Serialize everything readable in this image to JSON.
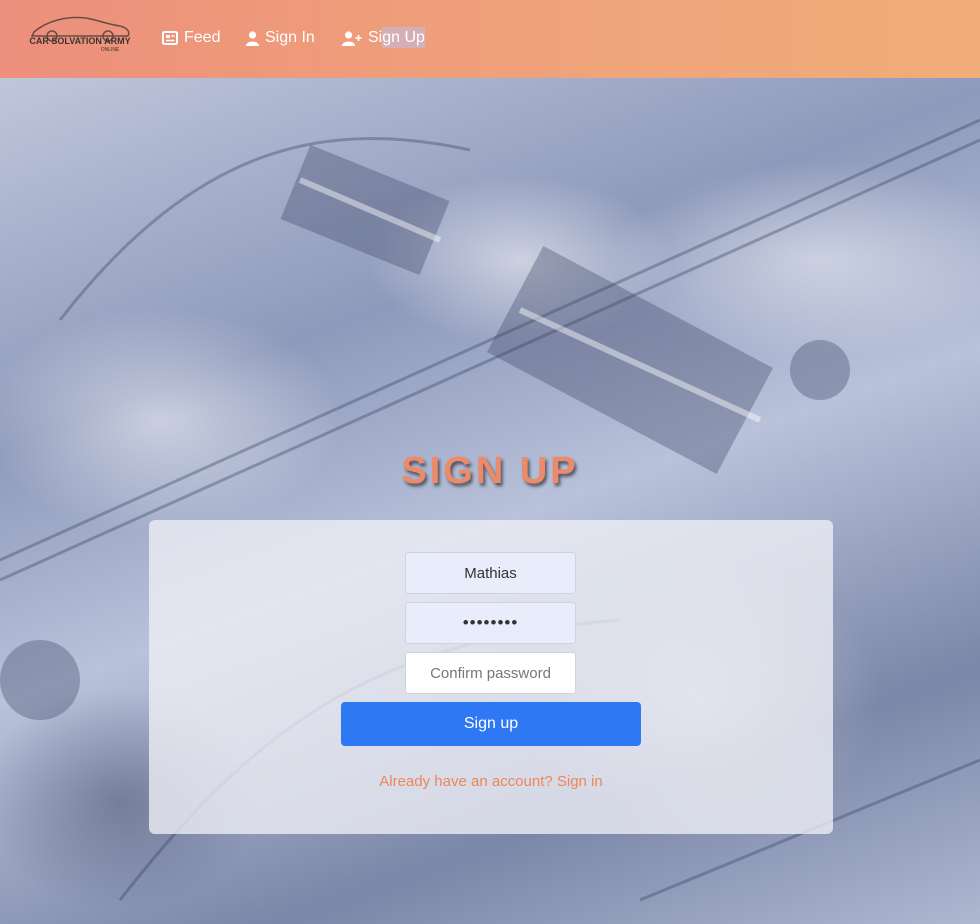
{
  "brand": {
    "logo_text": "CAR SOLVATION ARMY",
    "logo_subtext": "ONLINE"
  },
  "nav": {
    "feed": {
      "label": "Feed",
      "icon": "newspaper-icon"
    },
    "sign_in": {
      "label": "Sign In",
      "icon": "user-icon"
    },
    "sign_up": {
      "label_prefix": "Si",
      "label_highlight": "gn Up",
      "icon": "user-plus-icon"
    }
  },
  "page": {
    "title": "SIGN UP"
  },
  "form": {
    "username_value": "Mathias",
    "password_value": "••••••••",
    "confirm_placeholder": "Confirm password",
    "submit_label": "Sign up",
    "signin_link": "Already have an account? Sign in"
  },
  "colors": {
    "navbar_start": "#ec8f7c",
    "navbar_end": "#f1ad79",
    "title": "#ec8a6a",
    "button": "#2f78f3",
    "link": "#ee8656"
  }
}
